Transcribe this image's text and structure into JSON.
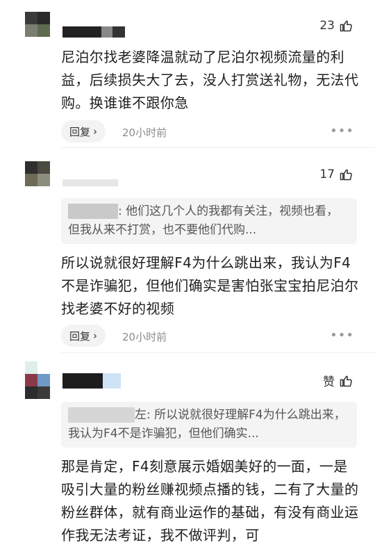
{
  "comments": [
    {
      "likes": "23",
      "text": "尼泊尔找老婆降温就动了尼泊尔视频流量的利益，后续损失大了去，没人打赏送礼物，无法代购。换谁谁不跟你急",
      "reply_label": "回复",
      "time": "20小时前"
    },
    {
      "likes": "17",
      "quote": ": 他们这几个人的我都有关注，视频也看，但我从来不打赏，也不要他们代购...",
      "text": "所以说就很好理解F4为什么跳出来，我认为F4不是诈骗犯，但他们确实是害怕张宝宝拍尼泊尔找老婆不好的视频",
      "reply_label": "回复",
      "time": "20小时前"
    },
    {
      "likes": "赞",
      "quote": "左: 所以说就很好理解F4为什么跳出来，我认为F4不是诈骗犯，但他们确实...",
      "text": "那是肯定，F4刻意展示婚姻美好的一面，一是吸引大量的粉丝赚视频点播的钱，二有了大量的粉丝群体，就有商业运作的基础，有没有商业运作我无法考证，我不做评判，可"
    }
  ],
  "icons": {
    "like": "thumbs-up-icon",
    "reply_arrow": "chevron-right-icon",
    "more": "more-dots-icon"
  }
}
